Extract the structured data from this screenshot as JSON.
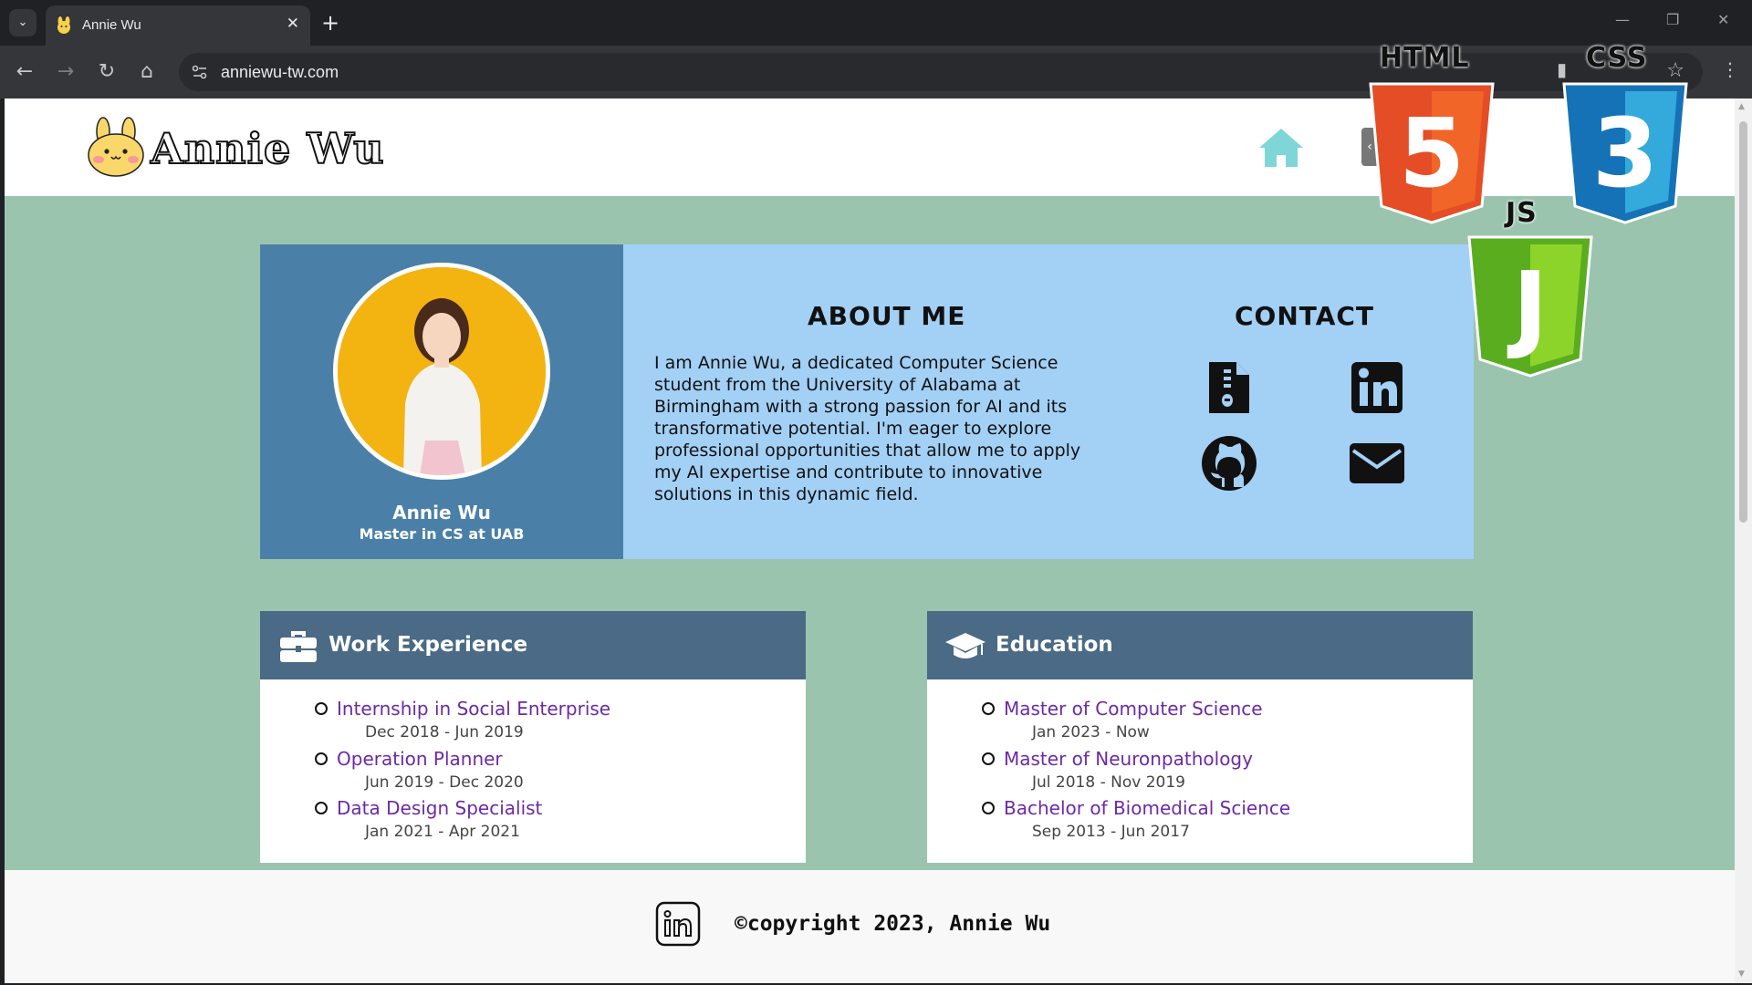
{
  "browser": {
    "tab_title": "Annie Wu",
    "url": "anniewu-tw.com",
    "icons": [
      "tab-list-icon",
      "close-icon",
      "plus-icon",
      "back-icon",
      "forward-icon",
      "reload-icon",
      "home-icon",
      "site-info-icon",
      "star-icon",
      "side-panel-icon",
      "more-icon"
    ]
  },
  "header": {
    "logo_text": "Annie Wu",
    "home_icon_color": "#7ed6d6"
  },
  "profile": {
    "name": "Annie Wu",
    "subtitle": "Master in CS at UAB"
  },
  "about": {
    "title": "ABOUT ME",
    "text": "I am Annie Wu, a dedicated Computer Science student from the University of Alabama at Birmingham with a strong passion for AI and its transformative potential. I'm eager to explore professional opportunities that allow me to apply my AI expertise and contribute to innovative solutions in this dynamic field."
  },
  "contact": {
    "title": "CONTACT",
    "icons": [
      "resume-file-icon",
      "linkedin-icon",
      "github-icon",
      "email-icon"
    ]
  },
  "work": {
    "title": "Work Experience",
    "items": [
      {
        "title": "Internship in Social Enterprise",
        "date": "Dec 2018 - Jun 2019"
      },
      {
        "title": "Operation Planner",
        "date": "Jun 2019 - Dec 2020"
      },
      {
        "title": "Data Design Specialist",
        "date": "Jan 2021 - Apr 2021"
      }
    ]
  },
  "education": {
    "title": "Education",
    "items": [
      {
        "title": "Master of Computer Science",
        "date": "Jan 2023 - Now"
      },
      {
        "title": "Master of Neuronpathology",
        "date": "Jul 2018 - Nov 2019"
      },
      {
        "title": "Bachelor of Biomedical Science",
        "date": "Sep 2013 - Jun 2017"
      }
    ]
  },
  "footer": {
    "copyright": "©copyright 2023, Annie Wu"
  },
  "overlay": {
    "html_label": "HTML",
    "html_digit": "5",
    "css_label": "CSS",
    "css_digit": "3",
    "js_label": "JS",
    "js_digit": "J"
  },
  "colors": {
    "page_bg": "#9ac4ae",
    "profile_panel": "#4a7fa8",
    "about_bg": "#a3d0f5",
    "section_header": "#4a6a85",
    "link_purple": "#6b2aa5",
    "html5_orange": "#e44d26",
    "css3_blue": "#1572b6",
    "js_green": "#5aad1f"
  }
}
